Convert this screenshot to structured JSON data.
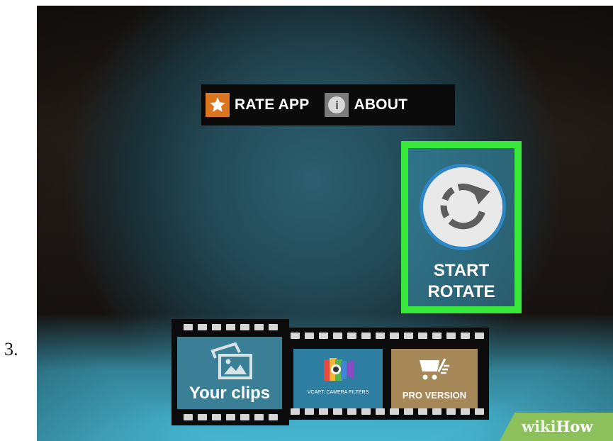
{
  "step": {
    "number": "3."
  },
  "app": {
    "top_bar": {
      "rate_label": "RATE APP",
      "about_label": "ABOUT",
      "rate_icon": "star-icon",
      "about_icon": "info-icon"
    },
    "start_rotate": {
      "label_line1": "START",
      "label_line2": "ROTATE",
      "icon": "rotate-icon",
      "highlight_color": "#37e83b"
    },
    "filmstrip": {
      "your_clips_label": "Your clips",
      "vcart_label": "VCART: CAMERA FILTERS",
      "pro_label": "PRO VERSION"
    }
  },
  "watermark": {
    "wiki": "wiki",
    "how": "How"
  },
  "colors": {
    "rate_orange": "#d9761f",
    "about_gray": "#7b7b7b",
    "rotate_ring_blue": "#2f86c4",
    "watermark_green": "#8cc05a"
  }
}
